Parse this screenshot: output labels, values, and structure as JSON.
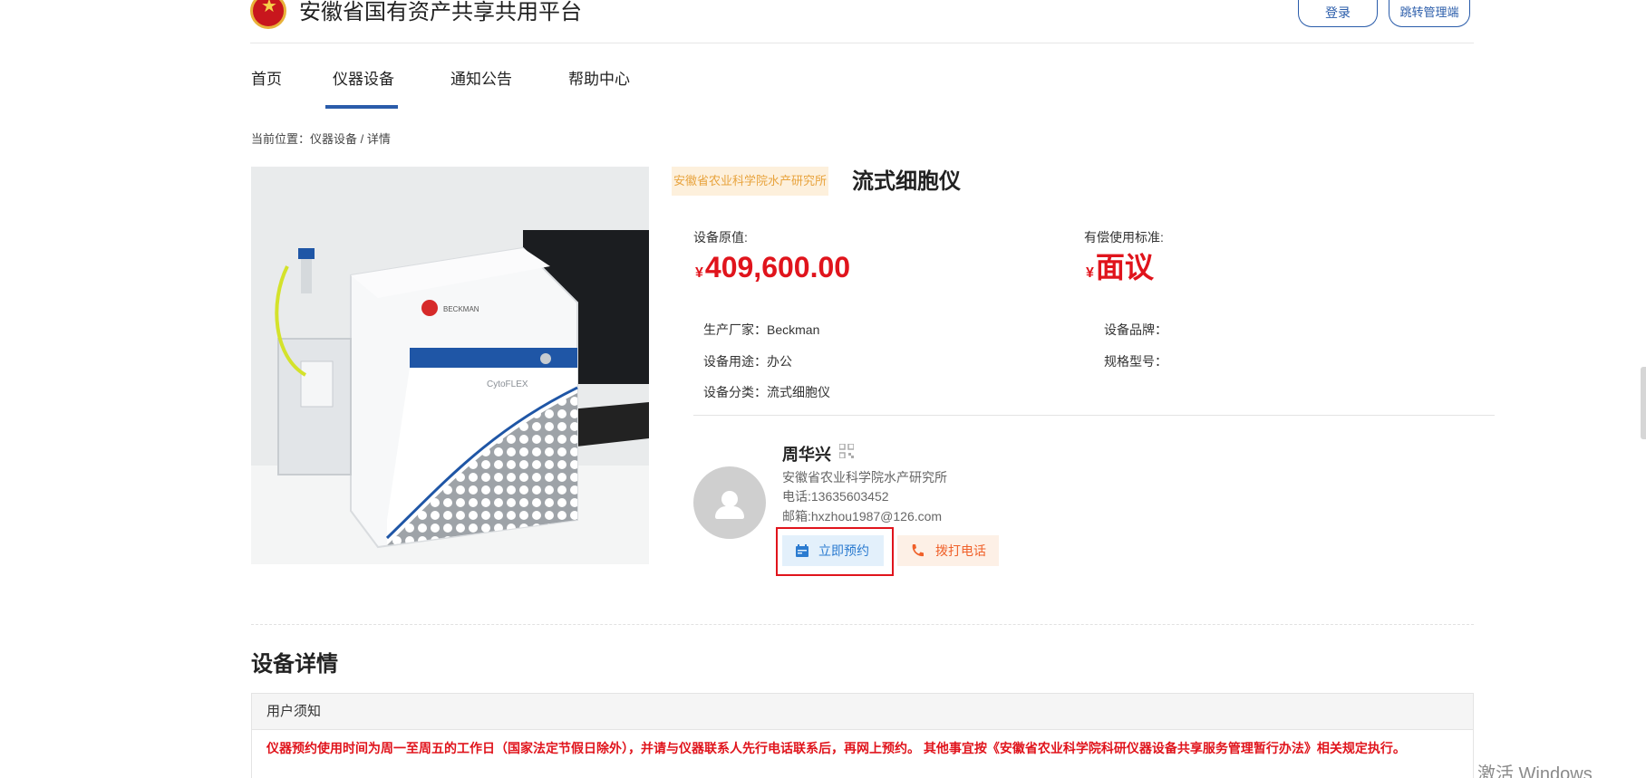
{
  "header": {
    "site_title": "安徽省国有资产共享共用平台",
    "login_label": "登录",
    "admin_label": "跳转管理端"
  },
  "nav": {
    "items": [
      {
        "label": "首页",
        "active": false
      },
      {
        "label": "仪器设备",
        "active": true
      },
      {
        "label": "通知公告",
        "active": false
      },
      {
        "label": "帮助中心",
        "active": false
      }
    ],
    "accent_color": "#2a5caa"
  },
  "breadcrumb": "当前位置：仪器设备 / 详情",
  "device": {
    "org_tag": "安徽省农业科学院水产研究所",
    "title": "流式细胞仪",
    "price": {
      "original_label": "设备原值:",
      "original_currency": "¥",
      "original_value": "409,600.00",
      "usage_label": "有偿使用标准:",
      "usage_currency": "¥",
      "usage_value": "面议",
      "price_color": "#e0141c"
    },
    "specs": {
      "manufacturer": "生产厂家：Beckman",
      "purpose": "设备用途：办公",
      "category": "设备分类：流式细胞仪",
      "brand": "设备品牌：",
      "model": "规格型号："
    },
    "photo_icon": "flow-cytometer-photo"
  },
  "contact": {
    "name": "周华兴",
    "qr_icon": "qr-code-icon",
    "org": "安徽省农业科学院水产研究所",
    "phone": "电话:13635603452",
    "email": "邮箱:hxzhou1987@126.com",
    "book_label": "立即预约",
    "call_label": "拨打电话"
  },
  "details": {
    "section_title": "设备详情",
    "notice_title": "用户须知",
    "notice_text": "仪器预约使用时间为周一至周五的工作日（国家法定节假日除外），并请与仪器联系人先行电话联系后，再网上预约。 其他事宜按《安徽省农业科学院科研仪器设备共享服务管理暂行办法》相关规定执行。"
  },
  "watermark": "激活 Windows"
}
